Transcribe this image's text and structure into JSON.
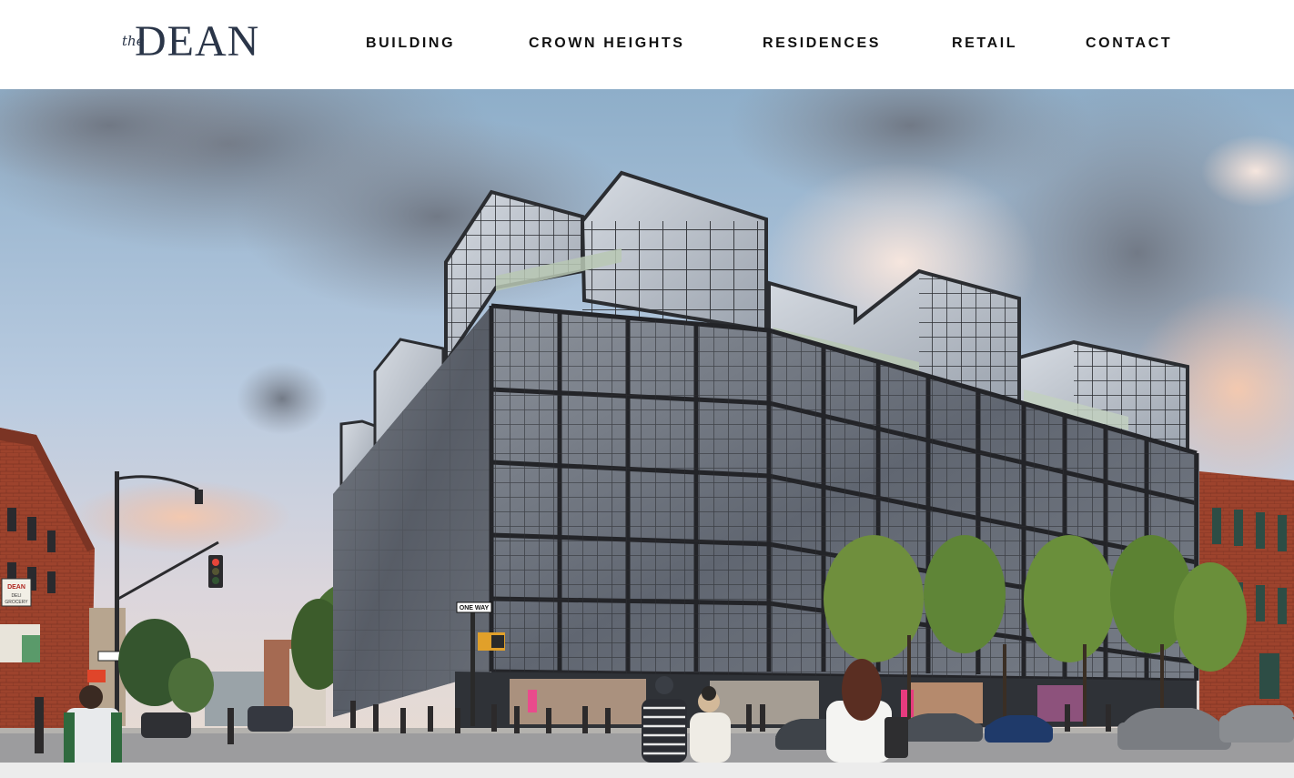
{
  "brand": {
    "logo_prefix": "the",
    "logo_name": "DEAN",
    "logo_color": "#2a3548"
  },
  "nav": {
    "items": [
      {
        "label": "BUILDING"
      },
      {
        "label": "CROWN HEIGHTS"
      },
      {
        "label": "RESIDENCES"
      },
      {
        "label": "RETAIL"
      },
      {
        "label": "CONTACT"
      }
    ]
  },
  "hero": {
    "sign_deli": "DEAN DELI GROCERY",
    "sign_oneway": "ONE WAY"
  },
  "colors": {
    "text": "#111111",
    "brick": "#a0442e",
    "building_frame": "#2b2d31",
    "footer_strip": "#ececec"
  }
}
